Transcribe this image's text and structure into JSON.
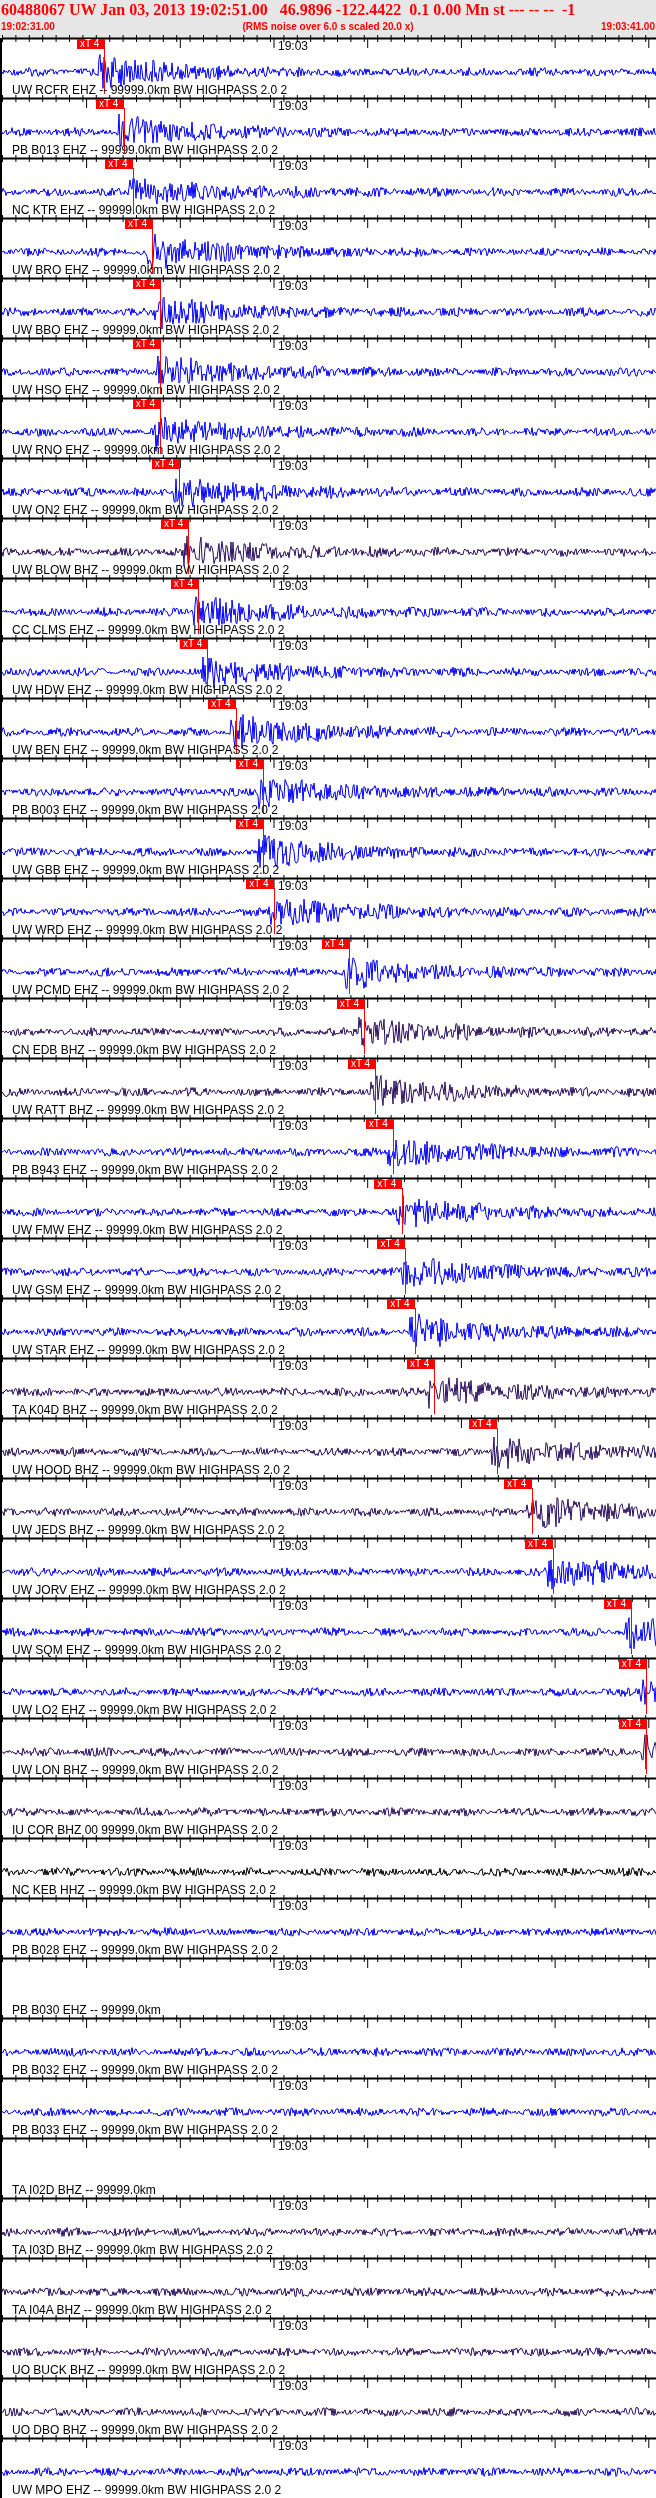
{
  "header": {
    "title": "60488067 UW Jan 03, 2013 19:02:51.00   46.9896 -122.4422  0.1 0.00 Mn st --- -- --  -1",
    "start_time": "19:02:31.00",
    "note": "(RMS noise over 6.0 s scaled 20.0 x)",
    "end_time": "19:03:41.00"
  },
  "traces": [
    {
      "label": "UW RCFR EHZ -- 99999.0km BW HIGHPASS 2.0 2",
      "tick_label": "19:03",
      "color": "#0000ff",
      "has_signal": true,
      "pick": {
        "label": "xT 4",
        "level": 0.157
      }
    },
    {
      "label": "PB B013 EHZ -- 99999.0km BW HIGHPASS 2.0 2",
      "tick_label": "19:03",
      "color": "#0000ff",
      "has_signal": true,
      "pick": {
        "label": "xT 4",
        "level": 0.186
      }
    },
    {
      "label": "NC KTR EHZ -- 99999.0km BW HIGHPASS 2.0 2",
      "tick_label": "19:03",
      "color": "#0000ff",
      "has_signal": true,
      "pick": {
        "label": "xT 4",
        "level": 0.2
      }
    },
    {
      "label": "UW BRO EHZ -- 99999.0km BW HIGHPASS 2.0 2",
      "tick_label": "19:03",
      "color": "#0000ff",
      "has_signal": true,
      "pick": {
        "label": "xT 4",
        "level": 0.23
      }
    },
    {
      "label": "UW BBO EHZ -- 99999.0km BW HIGHPASS 2.0 2",
      "tick_label": "19:03",
      "color": "#0000ff",
      "has_signal": true,
      "pick": {
        "label": "xT 4",
        "level": 0.242
      }
    },
    {
      "label": "UW HSO EHZ -- 99999.0km BW HIGHPASS 2.0 2",
      "tick_label": "19:03",
      "color": "#0000ff",
      "has_signal": true,
      "pick": {
        "label": "xT 4",
        "level": 0.242
      }
    },
    {
      "label": "UW RNO EHZ -- 99999.0km BW HIGHPASS 2.0 2",
      "tick_label": "19:03",
      "color": "#0000ff",
      "has_signal": true,
      "pick": {
        "label": "xT 4",
        "level": 0.242
      }
    },
    {
      "label": "UW ON2 EHZ -- 99999.0km BW HIGHPASS 2.0 2",
      "tick_label": "19:03",
      "color": "#0000ff",
      "has_signal": true,
      "pick": {
        "label": "xT 4",
        "level": 0.271
      }
    },
    {
      "label": "UW BLOW BHZ -- 99999.0km BW HIGHPASS 2.0 2",
      "tick_label": "19:03",
      "color": "#2b0f5e",
      "has_signal": true,
      "pick": {
        "label": "xT 4",
        "level": 0.285
      }
    },
    {
      "label": "CC CLMS EHZ -- 99999.0km BW HIGHPASS 2.0 2",
      "tick_label": "19:03",
      "color": "#0000ff",
      "has_signal": true,
      "pick": {
        "label": "xT 4",
        "level": 0.3
      }
    },
    {
      "label": "UW HDW EHZ -- 99999.0km BW HIGHPASS 2.0 2",
      "tick_label": "19:03",
      "color": "#0000ff",
      "has_signal": true,
      "pick": {
        "label": "xT 4",
        "level": 0.314
      }
    },
    {
      "label": "UW BEN EHZ -- 99999.0km BW HIGHPASS 2.0 2",
      "tick_label": "19:03",
      "color": "#0000ff",
      "has_signal": true,
      "pick": {
        "label": "xT 4",
        "level": 0.357
      }
    },
    {
      "label": "PB B003 EHZ -- 99999.0km BW HIGHPASS 2.0 2",
      "tick_label": "19:03",
      "color": "#0000ff",
      "has_signal": true,
      "pick": {
        "label": "xT 4",
        "level": 0.399
      }
    },
    {
      "label": "UW GBB EHZ -- 99999.0km BW HIGHPASS 2.0 2",
      "tick_label": "19:03",
      "color": "#0000ff",
      "has_signal": true,
      "pick": {
        "label": "xT 4",
        "level": 0.399
      }
    },
    {
      "label": "UW WRD EHZ -- 99999.0km BW HIGHPASS 2.0 2",
      "tick_label": "19:03",
      "color": "#0000ff",
      "has_signal": true,
      "pick": {
        "label": "xT 4",
        "level": 0.415
      }
    },
    {
      "label": "UW PCMD EHZ -- 99999.0km BW HIGHPASS 2.0 2",
      "tick_label": "19:03",
      "color": "#0000ff",
      "has_signal": true,
      "pick": {
        "label": "xT 4",
        "level": 0.53
      }
    },
    {
      "label": "CN EDB BHZ -- 99999.0km BW HIGHPASS 2.0 2",
      "tick_label": "19:03",
      "color": "#2b0f5e",
      "has_signal": true,
      "pick": {
        "label": "xT 4",
        "level": 0.553
      }
    },
    {
      "label": "UW RATT BHZ -- 99999.0km BW HIGHPASS 2.0 2",
      "tick_label": "19:03",
      "color": "#2b0f5e",
      "has_signal": true,
      "pick": {
        "label": "xT 4",
        "level": 0.57
      }
    },
    {
      "label": "PB B943 EHZ -- 99999.0km BW HIGHPASS 2.0 2",
      "tick_label": "19:03",
      "color": "#0000ff",
      "has_signal": true,
      "pick": {
        "label": "xT 4",
        "level": 0.597
      }
    },
    {
      "label": "UW FMW EHZ -- 99999.0km BW HIGHPASS 2.0 2",
      "tick_label": "19:03",
      "color": "#0000ff",
      "has_signal": true,
      "pick": {
        "label": "xT 4",
        "level": 0.61
      }
    },
    {
      "label": "UW GSM EHZ -- 99999.0km BW HIGHPASS 2.0 2",
      "tick_label": "19:03",
      "color": "#0000ff",
      "has_signal": true,
      "pick": {
        "label": "xT 4",
        "level": 0.615
      }
    },
    {
      "label": "UW STAR EHZ -- 99999.0km BW HIGHPASS 2.0 2",
      "tick_label": "19:03",
      "color": "#0000ff",
      "has_signal": true,
      "pick": {
        "label": "xT 4",
        "level": 0.63
      }
    },
    {
      "label": "TA K04D BHZ -- 99999.0km BW HIGHPASS 2.0 2",
      "tick_label": "19:03",
      "color": "#2b0f5e",
      "has_signal": true,
      "pick": {
        "label": "xT 4",
        "level": 0.66
      }
    },
    {
      "label": "UW HOOD BHZ -- 99999.0km BW HIGHPASS 2.0 2",
      "tick_label": "19:03",
      "color": "#2b0f5e",
      "has_signal": true,
      "pick": {
        "label": "xT 4",
        "level": 0.755
      }
    },
    {
      "label": "UW JEDS BHZ -- 99999.0km BW HIGHPASS 2.0 2",
      "tick_label": "19:03",
      "color": "#2b0f5e",
      "has_signal": true,
      "pick": {
        "label": "xT 4",
        "level": 0.808
      }
    },
    {
      "label": "UW JORV EHZ -- 99999.0km BW HIGHPASS 2.0 2",
      "tick_label": "19:03",
      "color": "#0000ff",
      "has_signal": true,
      "pick": {
        "label": "xT 4",
        "level": 0.84
      }
    },
    {
      "label": "UW SQM EHZ -- 99999.0km BW HIGHPASS 2.0 2",
      "tick_label": "19:03",
      "color": "#0000ff",
      "has_signal": true,
      "pick": {
        "label": "xT 4",
        "level": 0.96
      }
    },
    {
      "label": "UW LO2 EHZ -- 99999.0km BW HIGHPASS 2.0 2",
      "tick_label": "19:03",
      "color": "#0000ff",
      "has_signal": true,
      "pick": {
        "label": "xT 4",
        "level": 0.983
      }
    },
    {
      "label": "UW LON BHZ -- 99999.0km BW HIGHPASS 2.0 2",
      "tick_label": "19:03",
      "color": "#2b0f5e",
      "has_signal": true,
      "pick": {
        "label": "xT 4",
        "level": 0.983
      }
    },
    {
      "label": "IU COR BHZ 00 99999.0km BW HIGHPASS 2.0 2",
      "tick_label": "19:03",
      "color": "#2b0f5e",
      "has_signal": true
    },
    {
      "label": "NC KEB HHZ -- 99999.0km BW HIGHPASS 2.0 2",
      "tick_label": "19:03",
      "color": "#000000",
      "has_signal": true
    },
    {
      "label": "PB B028 EHZ -- 99999.0km BW HIGHPASS 2.0 2",
      "tick_label": "19:03",
      "color": "#0000ff",
      "has_signal": true
    },
    {
      "label": "PB B030 EHZ -- 99999.0km",
      "tick_label": "19:03",
      "has_signal": false
    },
    {
      "label": "PB B032 EHZ -- 99999.0km BW HIGHPASS 2.0 2",
      "tick_label": "19:03",
      "color": "#0000ff",
      "has_signal": true
    },
    {
      "label": "PB B033 EHZ -- 99999.0km BW HIGHPASS 2.0 2",
      "tick_label": "19:03",
      "color": "#0000ff",
      "has_signal": true
    },
    {
      "label": "TA I02D BHZ -- 99999.0km",
      "tick_label": "19:03",
      "has_signal": false
    },
    {
      "label": "TA I03D BHZ -- 99999.0km BW HIGHPASS 2.0 2",
      "tick_label": "19:03",
      "color": "#2b0f5e",
      "has_signal": true
    },
    {
      "label": "TA I04A BHZ -- 99999.0km BW HIGHPASS 2.0 2",
      "tick_label": "19:03",
      "color": "#2b0f5e",
      "has_signal": true
    },
    {
      "label": "UO BUCK BHZ -- 99999.0km BW HIGHPASS 2.0 2",
      "tick_label": "19:03",
      "color": "#2b0f5e",
      "has_signal": true
    },
    {
      "label": "UO DBO BHZ -- 99999.0km BW HIGHPASS 2.0 2",
      "tick_label": "19:03",
      "color": "#2b0f5e",
      "has_signal": true
    },
    {
      "label": "UW MPO EHZ -- 99999.0km BW HIGHPASS 2.0 2",
      "tick_label": "19:03",
      "color": "#0000ff",
      "has_signal": true
    }
  ]
}
